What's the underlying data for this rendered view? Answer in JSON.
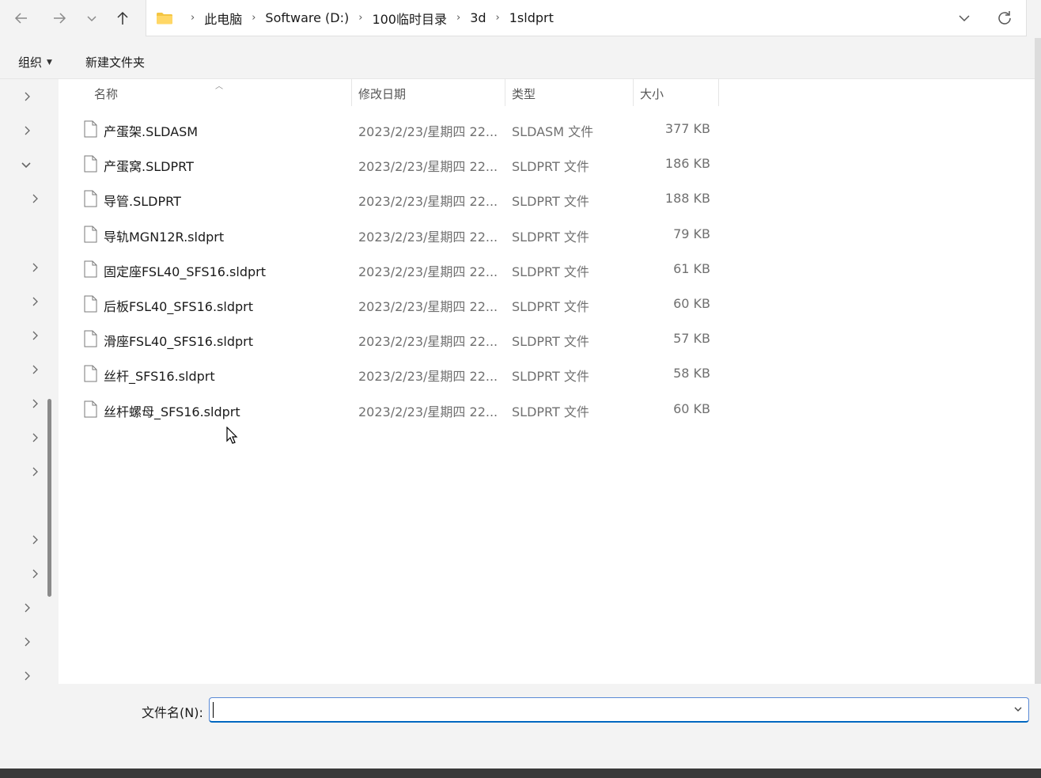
{
  "nav": {
    "back_icon": "arrow-left-icon",
    "forward_icon": "arrow-right-icon",
    "recent_icon": "chevron-down-icon",
    "up_icon": "arrow-up-icon"
  },
  "breadcrumb": [
    "此电脑",
    "Software (D:)",
    "100临时目录",
    "3d",
    "1sldprt"
  ],
  "commands": {
    "organize": "组织",
    "new_folder": "新建文件夹"
  },
  "columns": {
    "name": "名称",
    "date": "修改日期",
    "type": "类型",
    "size": "大小"
  },
  "files": [
    {
      "name": "产蛋架.SLDASM",
      "date": "2023/2/23/星期四 22...",
      "type": "SLDASM 文件",
      "size": "377 KB"
    },
    {
      "name": "产蛋窝.SLDPRT",
      "date": "2023/2/23/星期四 22...",
      "type": "SLDPRT 文件",
      "size": "186 KB"
    },
    {
      "name": "导管.SLDPRT",
      "date": "2023/2/23/星期四 22...",
      "type": "SLDPRT 文件",
      "size": "188 KB"
    },
    {
      "name": "导轨MGN12R.sldprt",
      "date": "2023/2/23/星期四 22...",
      "type": "SLDPRT 文件",
      "size": "79 KB"
    },
    {
      "name": "固定座FSL40_SFS16.sldprt",
      "date": "2023/2/23/星期四 22...",
      "type": "SLDPRT 文件",
      "size": "61 KB"
    },
    {
      "name": "后板FSL40_SFS16.sldprt",
      "date": "2023/2/23/星期四 22...",
      "type": "SLDPRT 文件",
      "size": "60 KB"
    },
    {
      "name": "滑座FSL40_SFS16.sldprt",
      "date": "2023/2/23/星期四 22...",
      "type": "SLDPRT 文件",
      "size": "57 KB"
    },
    {
      "name": "丝杆_SFS16.sldprt",
      "date": "2023/2/23/星期四 22...",
      "type": "SLDPRT 文件",
      "size": "58 KB"
    },
    {
      "name": "丝杆螺母_SFS16.sldprt",
      "date": "2023/2/23/星期四 22...",
      "type": "SLDPRT 文件",
      "size": "60 KB"
    }
  ],
  "navpane_chevrons": [
    "right",
    "right",
    "down",
    "right",
    "right",
    "right",
    "right",
    "right",
    "right",
    "right",
    "right",
    "right",
    "right",
    "right",
    "right",
    "right"
  ],
  "filename": {
    "label": "文件名(N):",
    "value": ""
  },
  "colors": {
    "accent": "#0067c0",
    "folder": "#f4c542"
  }
}
